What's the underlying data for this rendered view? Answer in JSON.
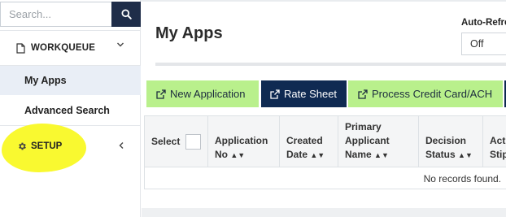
{
  "sidebar": {
    "search_placeholder": "Search...",
    "workqueue_label": "WORKQUEUE",
    "items": [
      {
        "label": "My Apps",
        "active": true
      },
      {
        "label": "Advanced Search",
        "active": false
      }
    ],
    "setup_label": "SETUP",
    "highlight_color": "#f9f930"
  },
  "header": {
    "title": "My Apps",
    "auto_refresh_label": "Auto-Refre",
    "auto_refresh_value": "Off"
  },
  "buttons": {
    "new_application": "New Application",
    "rate_sheet": "Rate Sheet",
    "process_payment": "Process Credit Card/ACH"
  },
  "table": {
    "select_label": "Select",
    "columns": [
      {
        "line1": "Application",
        "line2": "No",
        "sortable": true
      },
      {
        "line1": "Created",
        "line2": "Date",
        "sortable": true
      },
      {
        "line1": "Primary",
        "line2": "Applicant",
        "line3": "Name",
        "sortable": true
      },
      {
        "line1": "Decision",
        "line2": "Status",
        "sortable": true
      },
      {
        "line1": "Acti",
        "line2": "Stip"
      }
    ],
    "empty_message": "No records found."
  },
  "colors": {
    "navy": "#1f2d49",
    "button_green": "#b9f08c",
    "button_navy": "#0f2a52",
    "active_item_bg": "#e9eef6"
  }
}
